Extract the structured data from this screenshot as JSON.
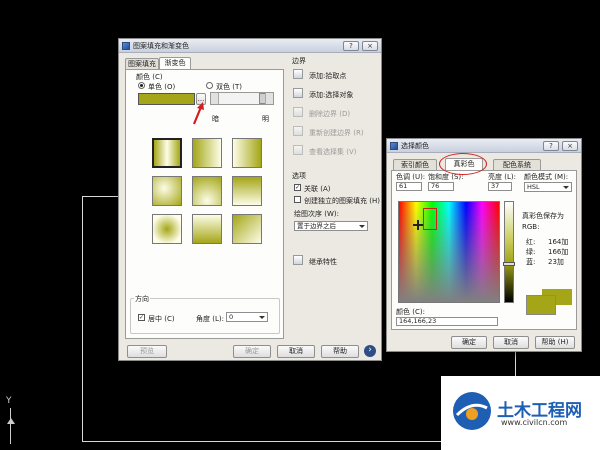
{
  "colors": {
    "fill": "#a4a617",
    "fill_light": "#fdfde8",
    "highlight_red": "#d41e1e"
  },
  "background": {
    "ucs_label": "Y"
  },
  "hatch_dialog": {
    "title": "图案填充和渐变色",
    "help_icon": "?",
    "close_icon": "×",
    "tabs": [
      {
        "label": "图案填充",
        "active": false
      },
      {
        "label": "渐变色",
        "active": true
      }
    ],
    "color_section": {
      "label": "颜色 (C)",
      "one_color_label": "单色 (O)",
      "two_color_label": "双色 (T)",
      "browse_button": "...",
      "dark_label": "暗",
      "light_label": "明",
      "slider_value": 0.9
    },
    "orientation": {
      "label": "方向",
      "centered_label": "居中 (C)",
      "centered_checked": true,
      "angle_label": "角度 (L):",
      "angle_value": "0"
    },
    "boundaries": {
      "label": "边界",
      "add_pick_points": "添加:拾取点",
      "add_select_objects": "添加:选择对象",
      "remove_boundaries": "删除边界 (D)",
      "recreate_boundary": "重新创建边界 (R)",
      "view_selections": "查看选择集 (V)"
    },
    "options": {
      "label": "选项",
      "associative_label": "关联 (A)",
      "associative_checked": true,
      "separate_label": "创建独立的图案填充 (H)",
      "separate_checked": false,
      "draw_order_label": "绘图次序 (W):",
      "draw_order_value": "置于边界之后"
    },
    "inherit_label": "继承特性",
    "buttons": {
      "preview": "预览",
      "ok": "确定",
      "cancel": "取消",
      "help": "帮助",
      "more_icon": "›"
    }
  },
  "color_dialog": {
    "title": "选择颜色",
    "help_icon": "?",
    "close_icon": "×",
    "tabs": [
      {
        "label": "索引颜色",
        "active": false
      },
      {
        "label": "真彩色",
        "active": true
      },
      {
        "label": "配色系统",
        "active": false
      }
    ],
    "hue_label": "色调 (U):",
    "hue_value": "61",
    "saturation_label": "饱和度 (S):",
    "saturation_value": "76",
    "luminance_label": "亮度 (L):",
    "luminance_value": "37",
    "color_model_label": "颜色模式 (M):",
    "color_model_value": "HSL",
    "save_as_label": "真彩色保存为",
    "save_as_label2": "RGB:",
    "red_label": "红:",
    "red_value": "164加",
    "green_label": "绿:",
    "green_value": "166加",
    "blue_label": "蓝:",
    "blue_value": "23加",
    "color_label": "颜色 (C):",
    "color_value": "164,166,23",
    "buttons": {
      "ok": "确定",
      "cancel": "取消",
      "help": "帮助 (H)"
    }
  },
  "watermark": {
    "brand": "土木工程网",
    "url": "www.civilcn.com"
  }
}
